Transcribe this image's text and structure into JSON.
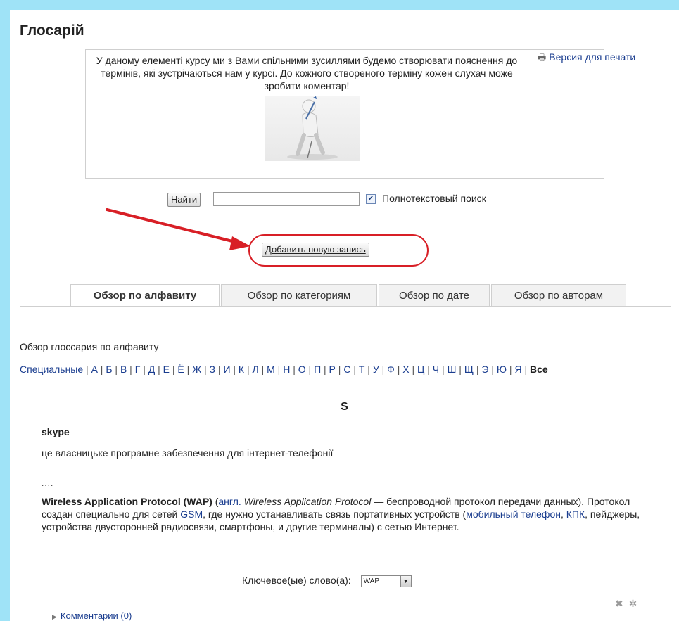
{
  "page": {
    "title": "Глосарій"
  },
  "intro": {
    "text": "У даному елементі курсу ми з Вами спільними зусиллями будемо створювати пояснення до термінів, які зустрічаються нам у курсі. До кожного створеного терміну кожен слухач може зробити коментар!"
  },
  "print": {
    "label": "Версия для печати",
    "icon": "printer-icon"
  },
  "search": {
    "button_label": "Найти",
    "input_value": "",
    "fulltext_checked": true,
    "fulltext_label": "Полнотекстовый поиск"
  },
  "add_entry": {
    "label": "Добавить новую запись",
    "highlight_color": "#d81f26"
  },
  "tabs": [
    {
      "label": "Обзор по алфавиту",
      "active": true
    },
    {
      "label": "Обзор по категориям",
      "active": false
    },
    {
      "label": "Обзор по дате",
      "active": false
    },
    {
      "label": "Обзор по авторам",
      "active": false
    }
  ],
  "browse": {
    "label": "Обзор глоссария по алфавиту",
    "special": "Специальные",
    "letters": [
      "А",
      "Б",
      "В",
      "Г",
      "Д",
      "Е",
      "Ё",
      "Ж",
      "З",
      "И",
      "К",
      "Л",
      "М",
      "Н",
      "О",
      "П",
      "Р",
      "С",
      "Т",
      "У",
      "Ф",
      "Х",
      "Ц",
      "Ч",
      "Ш",
      "Щ",
      "Э",
      "Ю",
      "Я"
    ],
    "all": "Все"
  },
  "section": {
    "letter": "S"
  },
  "entries": {
    "skype": {
      "term": "skype",
      "definition": "це власницьке програмне забезпечення для інтернет-телефонії"
    },
    "dots": "....",
    "wap": {
      "term": "Wireless Application Protocol (WAP)",
      "lang_open": " (",
      "lang_link": "англ.",
      "english": " Wireless Application Protocol",
      "desc1": " — беспроводной протокол передачи данных). Протокол создан специально для сетей ",
      "gsm": "GSM",
      "desc2": ", где нужно устанавливать связь портативных устройств (",
      "mobile": "мобильный телефон",
      "desc3": ", ",
      "kpk": "КПК",
      "desc4": ", пейджеры, устройства двусторонней радиосвязи, смартфоны, и другие терминалы) с сетью Интернет."
    }
  },
  "keywords": {
    "label": "Ключевое(ые) слово(а):",
    "selected": "WAP"
  },
  "comments": {
    "label": "Комментарии (0)"
  },
  "colors": {
    "link": "#1a3d8f",
    "background": "#9fe3f7"
  }
}
